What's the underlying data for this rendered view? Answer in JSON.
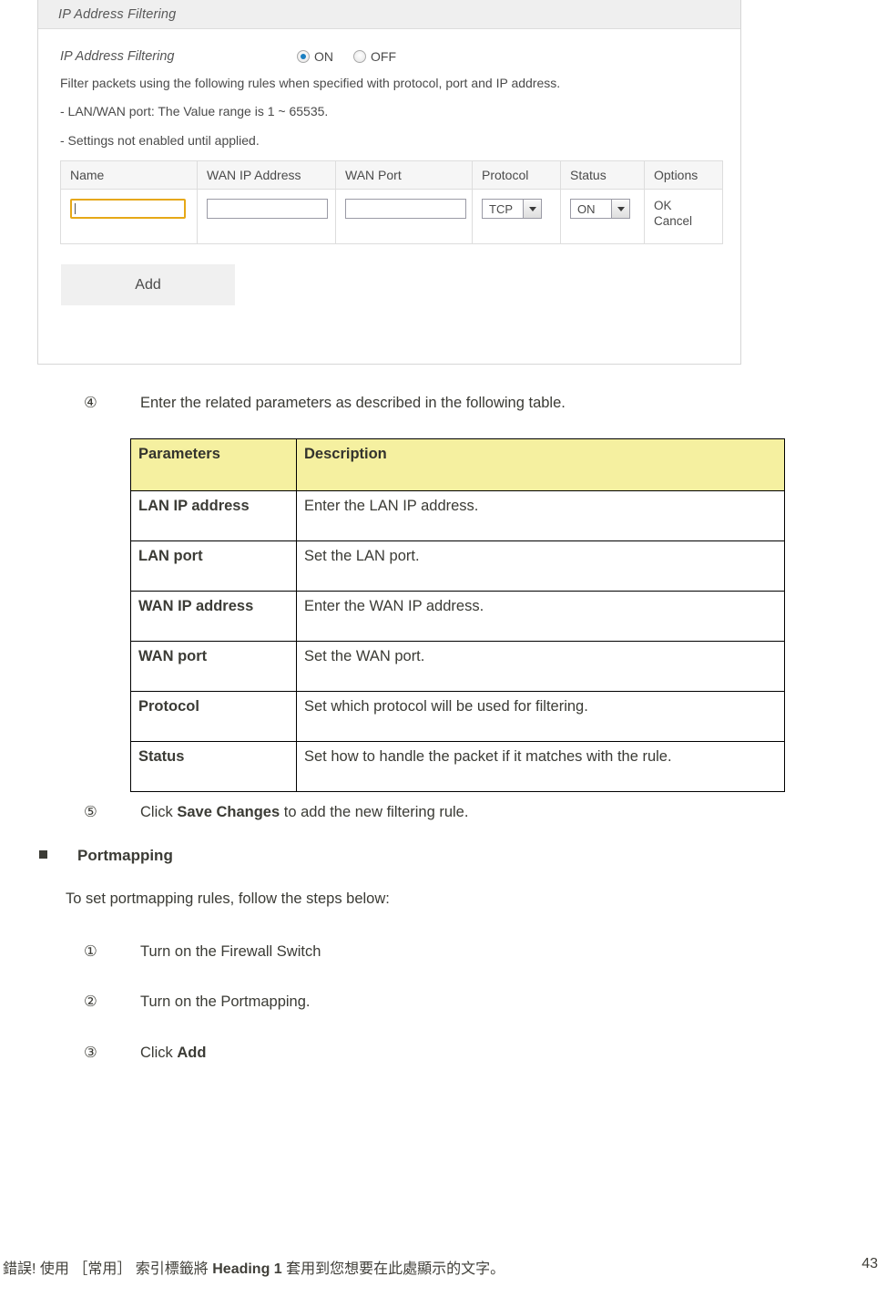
{
  "screenshot": {
    "panel_title": "IP Address Filtering",
    "setting": {
      "label": "IP Address Filtering",
      "options": [
        "ON",
        "OFF"
      ],
      "selected": "ON"
    },
    "notes": [
      "Filter packets using the following rules when specified with protocol, port and IP address.",
      "- LAN/WAN port: The Value range is 1 ~ 65535.",
      "- Settings not enabled until applied."
    ],
    "rule_table": {
      "headers": [
        "Name",
        "WAN IP Address",
        "WAN Port",
        "Protocol",
        "Status",
        "Options"
      ],
      "row": {
        "name_value": "",
        "wan_ip_value": "",
        "wan_port_value": "",
        "protocol_value": "TCP",
        "status_value": "ON",
        "ok_label": "OK",
        "cancel_label": "Cancel"
      }
    },
    "add_button": "Add"
  },
  "doc": {
    "step4": {
      "num": "④",
      "text": "Enter the related parameters as described in the following table."
    },
    "param_table": {
      "headers": [
        "Parameters",
        "Description"
      ],
      "rows": [
        {
          "parameter": "LAN IP address",
          "description": "Enter the LAN IP address."
        },
        {
          "parameter": "LAN port",
          "description": "Set the LAN port."
        },
        {
          "parameter": "WAN IP address",
          "description": "Enter the WAN IP address."
        },
        {
          "parameter": "WAN port",
          "description": "Set the WAN port."
        },
        {
          "parameter": "Protocol",
          "description": "Set which protocol will be used for filtering."
        },
        {
          "parameter": "Status",
          "description": "Set how to handle the packet if it matches with the rule."
        }
      ]
    },
    "step5": {
      "num": "⑤",
      "pre": "Click ",
      "bold": "Save Changes",
      "post": " to add the new filtering rule."
    },
    "portmapping_heading": "Portmapping",
    "portmapping_intro": "To set portmapping rules, follow the steps below:",
    "portmapping_steps": [
      {
        "num": "①",
        "pre": "Turn on the Firewall Switch",
        "bold": "",
        "post": ""
      },
      {
        "num": "②",
        "pre": "Turn on the Portmapping.",
        "bold": "",
        "post": ""
      },
      {
        "num": "③",
        "pre": "Click ",
        "bold": "Add",
        "post": ""
      }
    ]
  },
  "footer": {
    "pre": "錯誤! 使用 ［常用］ 索引標籤將 ",
    "bold": "Heading 1",
    "post": " 套用到您想要在此處顯示的文字。",
    "page": "43"
  }
}
